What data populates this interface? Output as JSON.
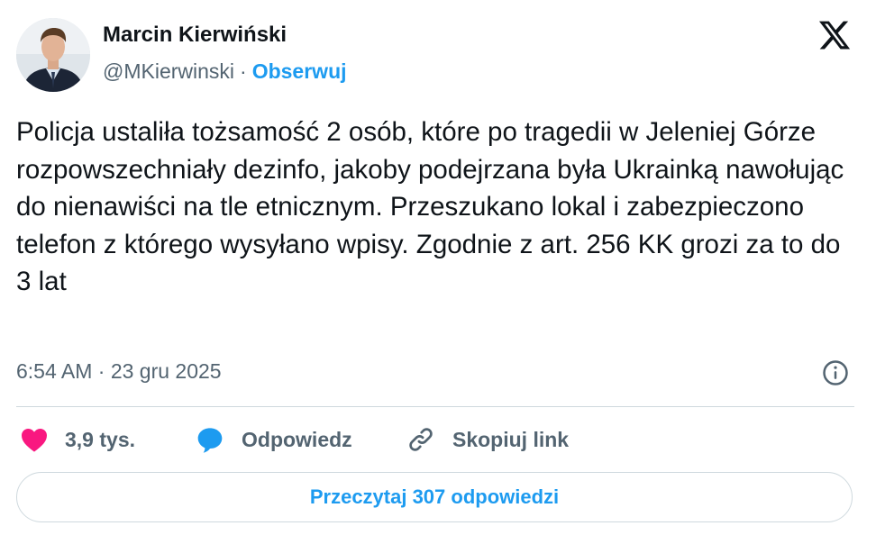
{
  "author": {
    "name": "Marcin Kierwiński",
    "handle": "@MKierwinski",
    "separator": "·",
    "follow_label": "Obserwuj",
    "avatar_icon": "person-photo"
  },
  "platform": {
    "logo_icon": "x-logo"
  },
  "tweet": {
    "text": "Policja ustaliła tożsamość 2 osób, które po tragedii w Jeleniej Górze rozpowszechniały dezinfo, jakoby podejrzana była Ukrainką nawołując do nienawiści na tle etnicznym. Przeszukano lokal i zabezpieczono telefon z którego wysyłano wpisy. Zgodnie z art. 256 KK grozi za to do 3 lat",
    "timestamp": "6:54 AM · 23 gru 2025"
  },
  "actions": {
    "like_count": "3,9 tys.",
    "reply_label": "Odpowiedz",
    "copy_link_label": "Skopiuj link",
    "read_replies_label": "Przeczytaj 307 odpowiedzi"
  },
  "colors": {
    "accent": "#1d9bf0",
    "like": "#f91880",
    "muted": "#536471",
    "text": "#0f1419",
    "border": "#cfd9de"
  }
}
